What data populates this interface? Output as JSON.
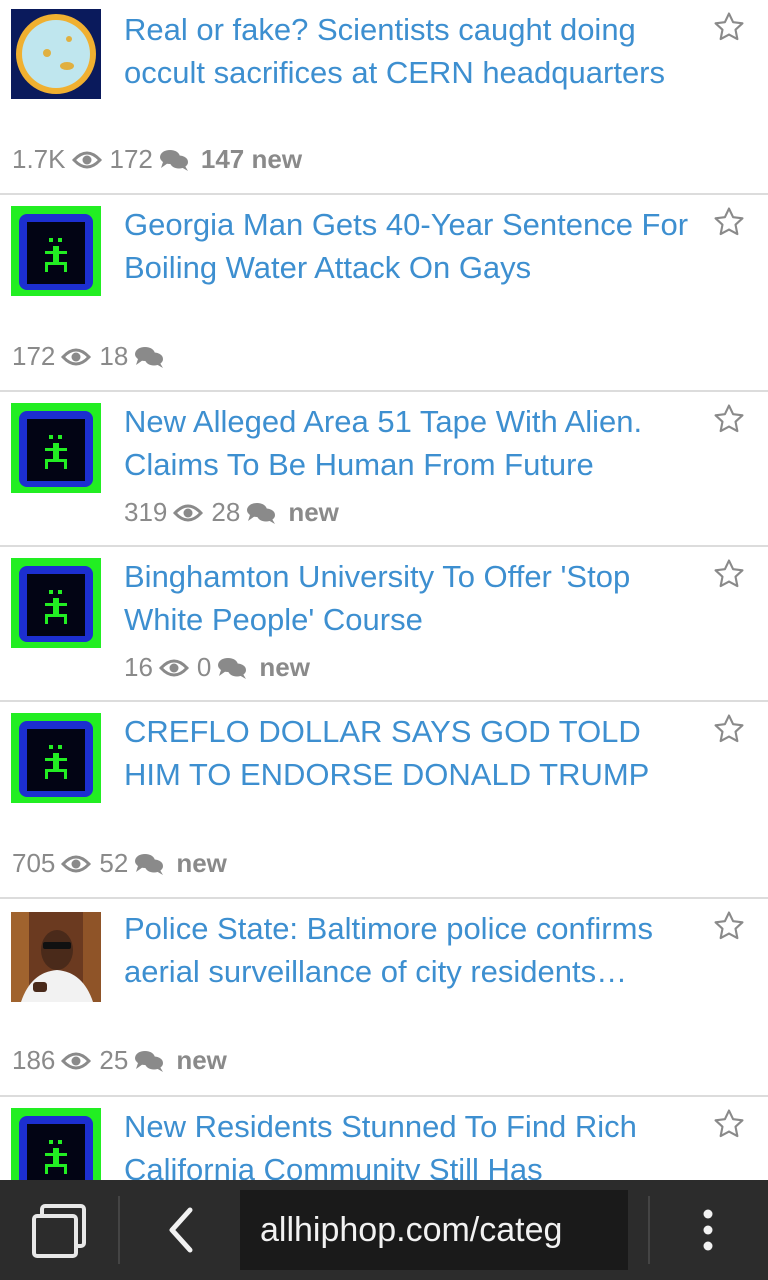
{
  "feed": {
    "items": [
      {
        "title": "Real or fake? Scientists caught doing occult sacrifices at CERN headquarters",
        "views": "1.7K",
        "comments": "172",
        "new_label": "147 new"
      },
      {
        "title": "Georgia Man Gets 40-Year Sentence For Boiling Water Attack On Gays",
        "views": "172",
        "comments": "18",
        "new_label": ""
      },
      {
        "title": "New Alleged Area 51 Tape With Alien. Claims To Be Human From Future",
        "views": "319",
        "comments": "28",
        "new_label": "new"
      },
      {
        "title": "Binghamton University To Offer 'Stop White People' Course",
        "views": "16",
        "comments": "0",
        "new_label": "new"
      },
      {
        "title": "CREFLO DOLLAR SAYS GOD TOLD HIM TO ENDORSE DONALD TRUMP",
        "views": "705",
        "comments": "52",
        "new_label": "new"
      },
      {
        "title": "Police State: Baltimore police confirms aerial surveillance of city residents…",
        "views": "186",
        "comments": "25",
        "new_label": "new"
      },
      {
        "title": "New Residents Stunned To Find Rich California Community Still Has",
        "views": "",
        "comments": "",
        "new_label": ""
      }
    ]
  },
  "browser": {
    "url": "allhiphop.com/categ"
  },
  "colors": {
    "title": "#3d8fd0",
    "meta": "#8a8a8a",
    "toolbar": "#2c2c2c",
    "thumb_green": "#22ee22",
    "thumb_blue": "#1c2fd0"
  },
  "icons": [
    "star-icon",
    "eye-icon",
    "comments-icon",
    "tabs-icon",
    "back-icon",
    "overflow-menu-icon"
  ]
}
